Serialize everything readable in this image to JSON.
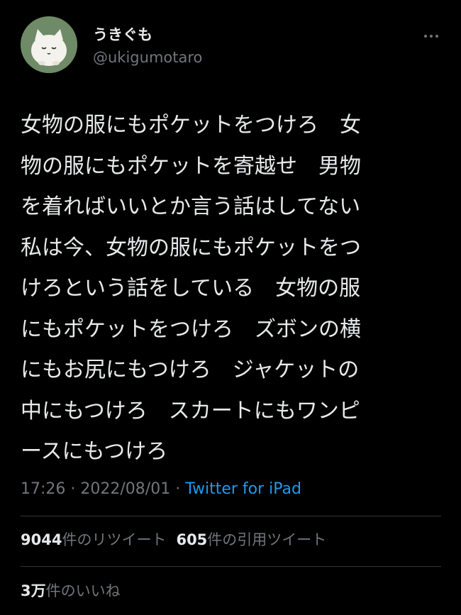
{
  "author": {
    "display_name": "うきぐも",
    "handle": "@ukigumotaro",
    "avatar_icon": "cat-avatar-icon"
  },
  "more_icon": "more-horizontal-icon",
  "tweet": {
    "lines": [
      "女物の服にもポケットをつけろ　女",
      "物の服にもポケットを寄越せ　男物",
      "を着ればいいとか言う話はしてない",
      "私は今、女物の服にもポケットをつ",
      "けろという話をしている　女物の服",
      "にもポケットをつけろ　ズボンの横",
      "にもお尻にもつけろ　ジャケットの",
      "中にもつけろ　スカートにもワンピ",
      "ースにもつけろ"
    ],
    "time": "17:26",
    "sep1": " · ",
    "date": "2022/08/01",
    "sep2": " · ",
    "source": "Twitter for iPad"
  },
  "stats": {
    "retweets_count": "9044",
    "retweets_label": "件のリツイート",
    "quotes_count": "605",
    "quotes_label": "件の引用ツイート",
    "likes_count": "3万",
    "likes_label": "件のいいね"
  },
  "colors": {
    "background": "#000000",
    "text": "#e7e9ea",
    "secondary": "#71767b",
    "link": "#1d9bf0",
    "avatar_bg": "#6e8a66"
  }
}
